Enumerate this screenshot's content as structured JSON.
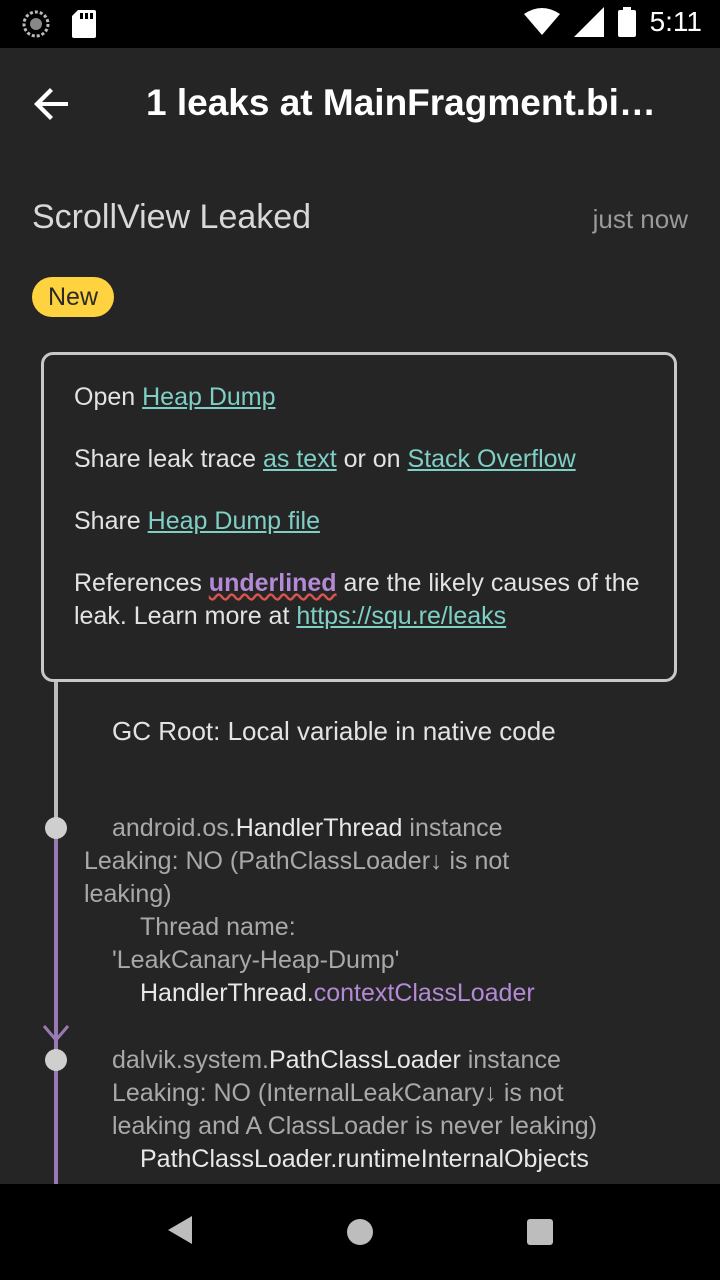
{
  "status_bar": {
    "time": "5:11",
    "icons": [
      "loading-icon",
      "sd-card-icon",
      "wifi-icon",
      "signal-icon",
      "battery-icon"
    ]
  },
  "app_bar": {
    "back_icon": "arrow-back-icon",
    "title": "1 leaks at MainFragment.bi…"
  },
  "leak": {
    "title": "ScrollView Leaked",
    "timestamp": "just now",
    "badge": "New"
  },
  "info_card": {
    "line1_prefix": "Open ",
    "line1_link": "Heap Dump",
    "line2_prefix": "Share leak trace ",
    "line2_link1": "as text",
    "line2_mid": " or on ",
    "line2_link2": "Stack Overflow",
    "line3_prefix": "Share ",
    "line3_link": "Heap Dump file",
    "line4_prefix": "References ",
    "line4_emph": "underlined",
    "line4_mid": " are the likely causes of the leak. Learn more at ",
    "line4_link": "https://squ.re/leaks"
  },
  "trace": {
    "gc_root": "GC Root: Local variable in native code",
    "node1": {
      "package": "android.os.",
      "class": "HandlerThread",
      "suffix": " instance",
      "leaking": "Leaking: NO (PathClassLoader↓ is not leaking)",
      "thread_label": "Thread name:",
      "thread_value": "'LeakCanary-Heap-Dump'",
      "ref_class": "HandlerThread.",
      "ref_field": "contextClassLoader"
    },
    "node2": {
      "package": "dalvik.system.",
      "class": "PathClassLoader",
      "suffix": " instance",
      "leaking": "Leaking: NO (InternalLeakCanary↓ is not leaking and A ClassLoader is never leaking)",
      "partial": "PathClassLoader.runtimeInternalObjects"
    }
  },
  "colors": {
    "background": "#252526",
    "badge": "#ffd33f",
    "link": "#7ecfc5",
    "reference": "#b48ad6"
  }
}
